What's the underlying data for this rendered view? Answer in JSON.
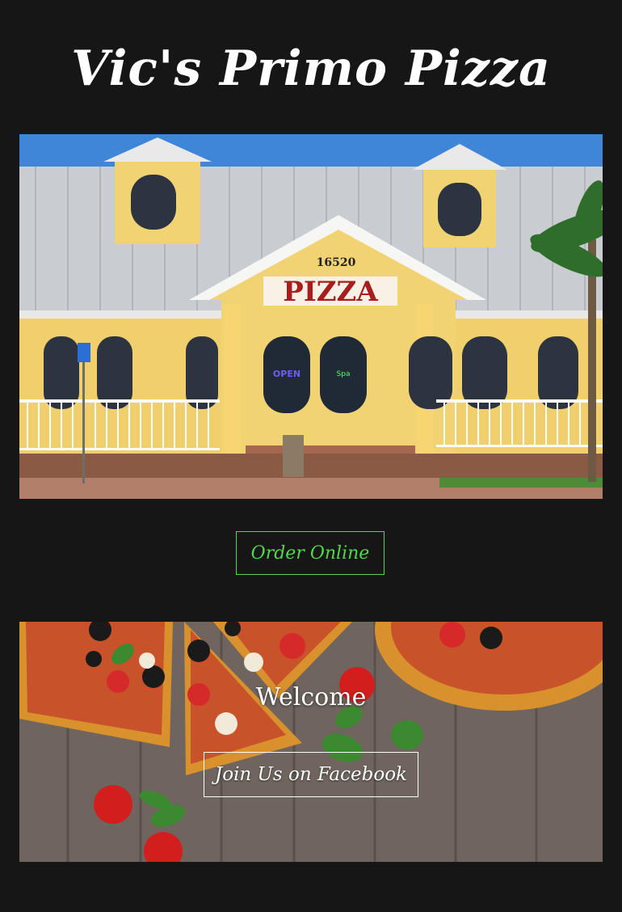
{
  "header": {
    "title": "Vic's Primo Pizza"
  },
  "hero": {
    "image_name": "restaurant-storefront-photo",
    "address_number": "16520",
    "sign_text": "PIZZA",
    "open_sign": "OPEN",
    "neon_sign": "Spa"
  },
  "order": {
    "label": "Order Online",
    "color": "#56d64b"
  },
  "welcome": {
    "image_name": "pizza-on-wood-photo",
    "heading": "Welcome",
    "facebook_label": "Join Us on Facebook"
  },
  "colors": {
    "background": "#161616",
    "accent": "#56d64b",
    "text": "#ffffff"
  }
}
